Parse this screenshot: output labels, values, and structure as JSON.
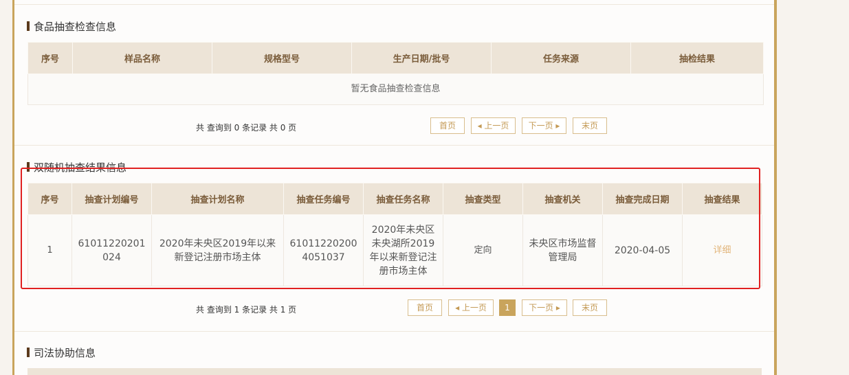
{
  "food": {
    "title": "食品抽查检查信息",
    "headers": [
      "序号",
      "样品名称",
      "规格型号",
      "生产日期/批号",
      "任务来源",
      "抽检结果"
    ],
    "empty_text": "暂无食品抽查检查信息",
    "pager": {
      "info": "共 查询到 0 条记录 共 0 页",
      "first": "首页",
      "prev": "◂ 上一页",
      "next": "下一页 ▸",
      "last": "末页"
    }
  },
  "random": {
    "title": "双随机抽查结果信息",
    "headers": [
      "序号",
      "抽查计划编号",
      "抽查计划名称",
      "抽查任务编号",
      "抽查任务名称",
      "抽查类型",
      "抽查机关",
      "抽查完成日期",
      "抽查结果"
    ],
    "rows": [
      {
        "no": "1",
        "plan_no": "61011220201024",
        "plan_name": "2020年未央区2019年以来新登记注册市场主体",
        "task_no": "610112202004051037",
        "task_name": "2020年未央区未央湖所2019年以来新登记注册市场主体",
        "type": "定向",
        "org": "未央区市场监督管理局",
        "date": "2020-04-05",
        "result": "详细"
      }
    ],
    "pager": {
      "info": "共 查询到 1 条记录 共 1 页",
      "first": "首页",
      "prev": "◂ 上一页",
      "current": "1",
      "next": "下一页 ▸",
      "last": "末页"
    }
  },
  "judicial": {
    "title": "司法协助信息"
  },
  "colors": {
    "accent": "#c9a45c",
    "header_bg": "#ede4d7",
    "highlight": "#e02020",
    "link": "#e2b57a"
  }
}
